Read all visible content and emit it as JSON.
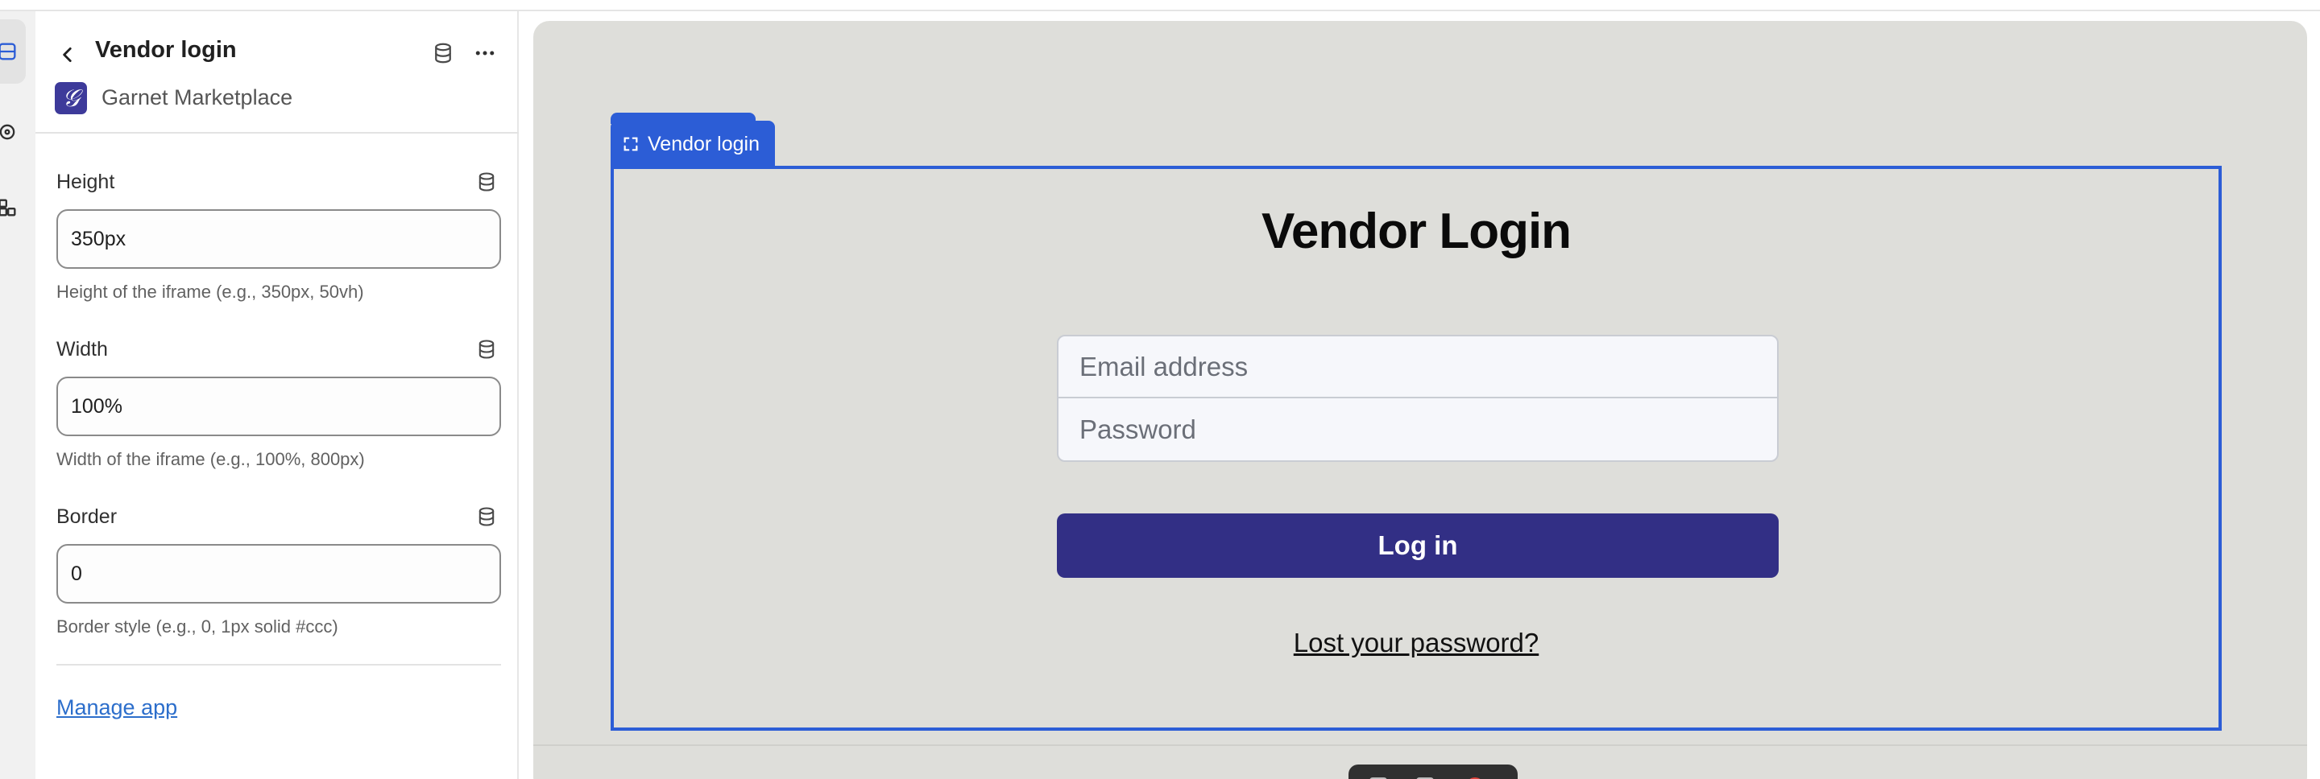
{
  "sidebar": {
    "title": "Vendor login",
    "app_name": "Garnet Marketplace",
    "icons": {
      "back": "chevron-left-icon",
      "database": "database-icon",
      "more": "more-horizontal-icon"
    },
    "fields": [
      {
        "label": "Height",
        "value": "350px",
        "help": "Height of the iframe (e.g., 350px, 50vh)"
      },
      {
        "label": "Width",
        "value": "100%",
        "help": "Width of the iframe (e.g., 100%, 800px)"
      },
      {
        "label": "Border",
        "value": "0",
        "help": "Border style (e.g., 0, 1px solid #ccc)"
      }
    ],
    "manage_link": "Manage app"
  },
  "canvas": {
    "selection_label": "Vendor login",
    "form": {
      "title": "Vendor Login",
      "email_placeholder": "Email address",
      "password_placeholder": "Password",
      "submit_label": "Log in",
      "lost_password": "Lost your password?"
    }
  },
  "colors": {
    "accent": "#2c5dd6",
    "button": "#322f85",
    "canvas_bg": "#dededa",
    "link": "#2c6ecb",
    "logo": "#3d3a9a"
  }
}
